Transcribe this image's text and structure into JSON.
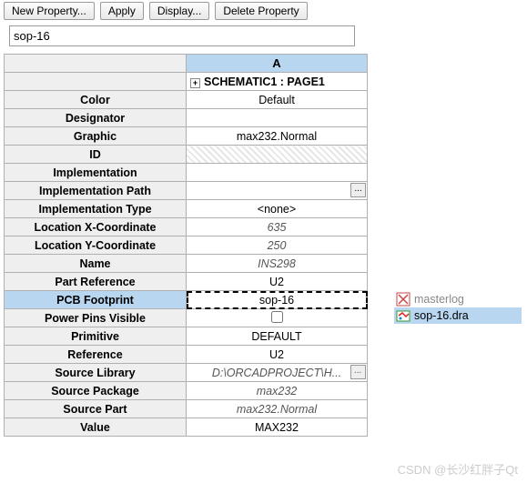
{
  "toolbar": {
    "new_property": "New Property...",
    "apply": "Apply",
    "display": "Display...",
    "delete": "Delete Property"
  },
  "input": {
    "value": "sop-16"
  },
  "grid": {
    "col_header": "A",
    "section_header": "SCHEMATIC1 : PAGE1",
    "rows": [
      {
        "label": "Color",
        "value": "Default"
      },
      {
        "label": "Designator",
        "value": ""
      },
      {
        "label": "Graphic",
        "value": "max232.Normal"
      },
      {
        "label": "ID",
        "value": "",
        "hatched": true
      },
      {
        "label": "Implementation",
        "value": ""
      },
      {
        "label": "Implementation Path",
        "value": "",
        "dots": true
      },
      {
        "label": "Implementation Type",
        "value": "<none>"
      },
      {
        "label": "Location X-Coordinate",
        "value": "635",
        "italic": true
      },
      {
        "label": "Location Y-Coordinate",
        "value": "250",
        "italic": true
      },
      {
        "label": "Name",
        "value": "INS298",
        "italic": true
      },
      {
        "label": "Part Reference",
        "value": "U2"
      },
      {
        "label": "PCB Footprint",
        "value": "sop-16",
        "selected": true
      },
      {
        "label": "Power Pins Visible",
        "value": "",
        "checkbox": true
      },
      {
        "label": "Primitive",
        "value": "DEFAULT"
      },
      {
        "label": "Reference",
        "value": "U2"
      },
      {
        "label": "Source Library",
        "value": "D:\\ORCADPROJECT\\H...",
        "italic": true,
        "dots": true
      },
      {
        "label": "Source Package",
        "value": "max232",
        "italic": true
      },
      {
        "label": "Source Part",
        "value": "max232.Normal",
        "italic": true
      },
      {
        "label": "Value",
        "value": "MAX232"
      }
    ]
  },
  "files": {
    "item0": "masterlog",
    "item1": "sop-16.dra"
  },
  "watermark": "CSDN @长沙红胖子Qt"
}
